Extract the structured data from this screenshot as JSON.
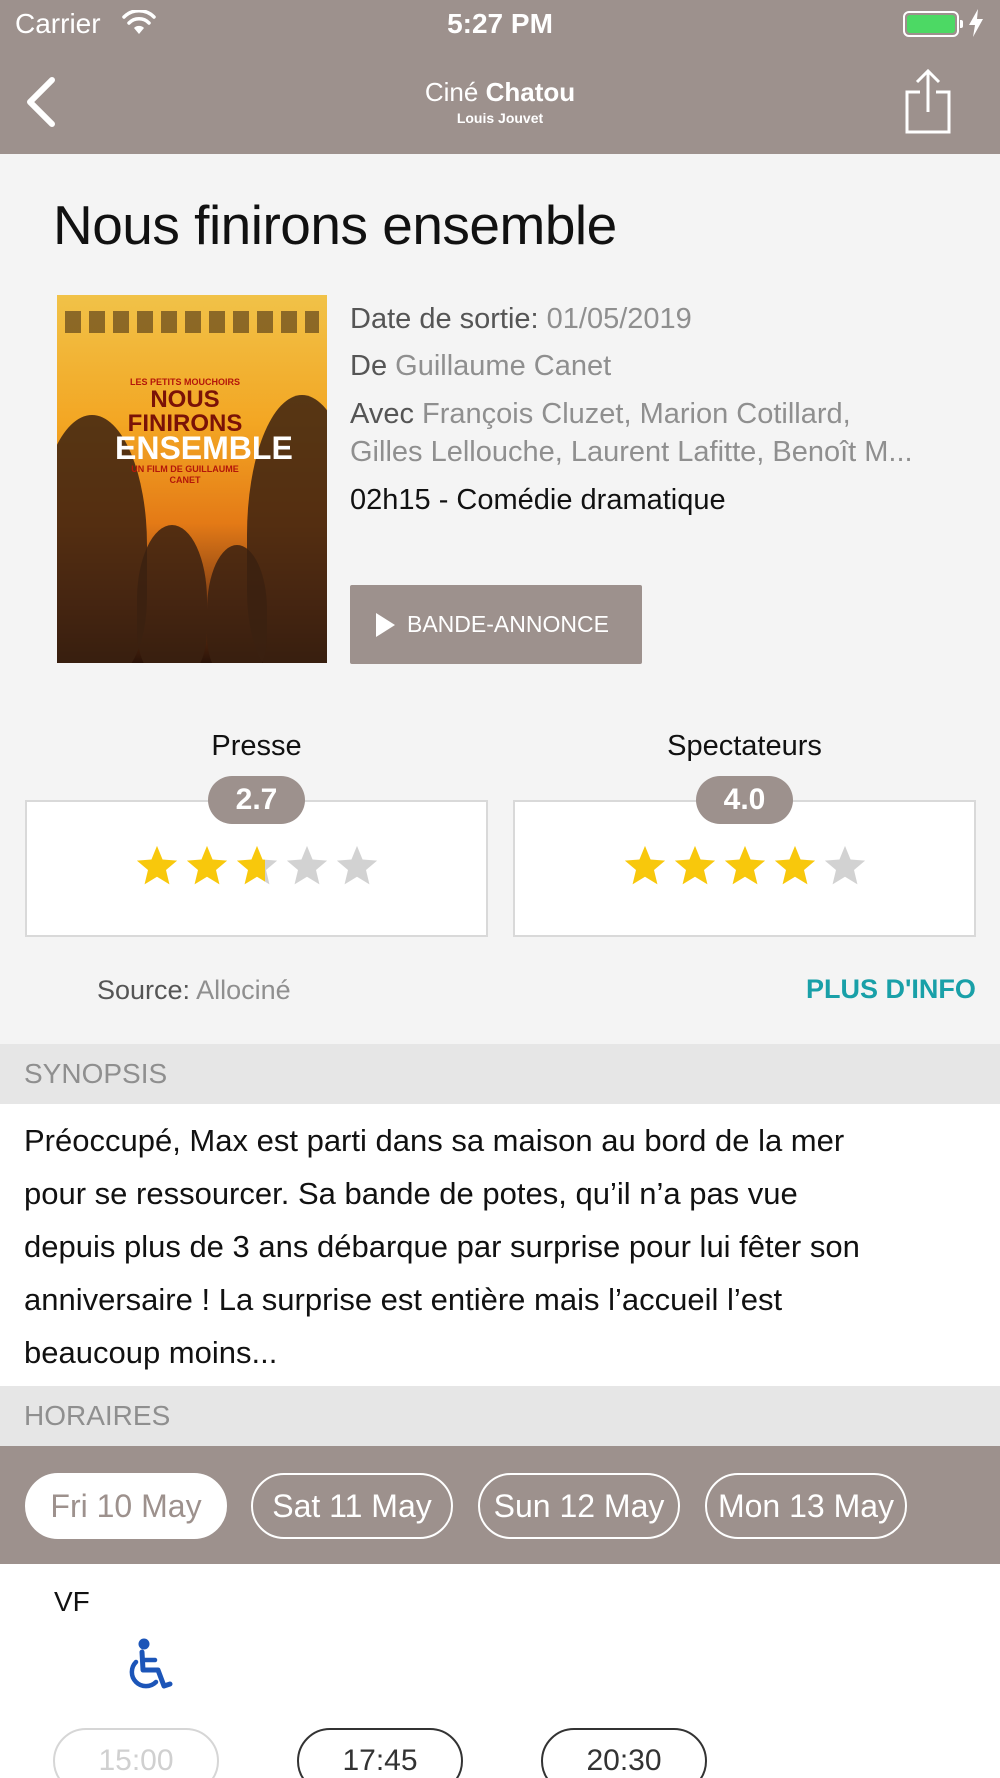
{
  "status_bar": {
    "carrier": "Carrier",
    "time": "5:27 PM"
  },
  "nav": {
    "logo_line1_a": "Ciné",
    "logo_line1_b": "Chatou",
    "logo_line2": "Louis Jouvet"
  },
  "movie": {
    "title": "Nous finirons ensemble",
    "release_label": "Date de sortie:",
    "release_date": "01/05/2019",
    "director_label": "De",
    "director": "Guillaume Canet",
    "cast_label": "Avec",
    "cast_line1": "François Cluzet, Marion Cotillard,",
    "cast_line2": "Gilles Lellouche, Laurent Lafitte, Benoît M...",
    "duration_genre": "02h15 - Comédie dramatique",
    "trailer_label": "BANDE-ANNONCE",
    "poster": {
      "line1": "NOUS FINIRONS",
      "line2": "ENSEMBLE",
      "line3": "UN FILM DE GUILLAUME CANET",
      "top": "LES PETITS MOUCHOIRS"
    }
  },
  "ratings": [
    {
      "label": "Presse",
      "score": "2.7",
      "value": 2.7,
      "max": 5
    },
    {
      "label": "Spectateurs",
      "score": "4.0",
      "value": 4.0,
      "max": 5
    }
  ],
  "source": {
    "label": "Source:",
    "value": "Allociné"
  },
  "more_info": "PLUS D'INFO",
  "synopsis": {
    "header": "SYNOPSIS",
    "lines": [
      "Préoccupé, Max est parti dans sa maison au bord de la mer",
      "pour se ressourcer. Sa bande de potes, qu’il n’a pas vue",
      "depuis plus de 3 ans débarque par surprise pour lui fêter son",
      "anniversaire ! La surprise est entière mais l’accueil l’est",
      "beaucoup moins..."
    ]
  },
  "schedule": {
    "header": "HORAIRES",
    "dates": [
      {
        "label": "Fri 10 May",
        "active": true
      },
      {
        "label": "Sat 11 May",
        "active": false
      },
      {
        "label": "Sun 12 May",
        "active": false
      },
      {
        "label": "Mon 13 May",
        "active": false
      }
    ],
    "version": "VF",
    "times": [
      {
        "label": "15:00",
        "past": true
      },
      {
        "label": "17:45",
        "past": false
      },
      {
        "label": "20:30",
        "past": false
      }
    ]
  },
  "colors": {
    "brand": "#9d918d",
    "accent": "#19a0a8",
    "star": "#f8c80c",
    "star_empty": "#d2d2d2",
    "wheelchair": "#1c55b8"
  }
}
